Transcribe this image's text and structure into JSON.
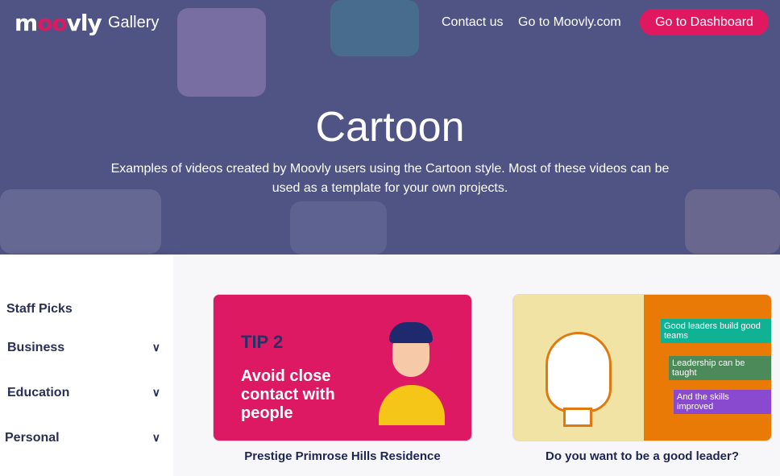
{
  "header": {
    "logo": "moovly",
    "gallery": "Gallery",
    "nav": [
      "Contact us",
      "Go to Moovly.com"
    ],
    "dashboard": "Go to Dashboard"
  },
  "hero": {
    "title": "Cartoon",
    "description": "Examples of videos created by Moovly users using the Cartoon style. Most of these videos can be used as a template for your own projects."
  },
  "sidebar": {
    "items": [
      {
        "label": "Staff Picks"
      },
      {
        "label": "Business"
      },
      {
        "label": "Education"
      },
      {
        "label": "Personal"
      }
    ]
  },
  "cards": [
    {
      "title": "Prestige Primrose Hills Residence",
      "thumb": {
        "tip": "TIP 2",
        "text": "Avoid close contact with people"
      }
    },
    {
      "title": "Do you want to be a good leader?",
      "thumb": {
        "tags": [
          "Good leaders build good teams",
          "Leadership can be taught",
          "And the skills improved"
        ]
      }
    }
  ],
  "colors": {
    "hero": "#4f5485",
    "accent": "#e0185f",
    "card1": "#dd1963",
    "orange": "#ea7a06"
  }
}
